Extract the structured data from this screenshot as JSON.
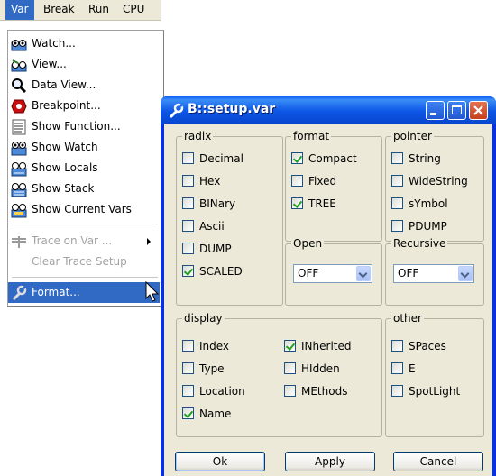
{
  "menubar": {
    "items": [
      {
        "label": "Var",
        "active": true
      },
      {
        "label": "Break"
      },
      {
        "label": "Run"
      },
      {
        "label": "CPU"
      }
    ]
  },
  "menu": {
    "items": [
      {
        "label": "Watch...",
        "icon": "watch-icon"
      },
      {
        "label": "View...",
        "icon": "view-icon"
      },
      {
        "label": "Data View...",
        "icon": "magnifier-icon"
      },
      {
        "label": "Breakpoint...",
        "icon": "breakpoint-icon"
      },
      {
        "label": "Show Function...",
        "icon": "function-icon"
      },
      {
        "label": "Show Watch",
        "icon": "watch-icon"
      },
      {
        "label": "Show Locals",
        "icon": "locals-icon"
      },
      {
        "label": "Show Stack",
        "icon": "stack-icon"
      },
      {
        "label": "Show Current Vars",
        "icon": "vars-icon"
      },
      {
        "label": "Trace on Var ...",
        "icon": "trace-icon",
        "disabled": true,
        "submenu": true
      },
      {
        "label": "Clear Trace Setup",
        "disabled": true
      },
      {
        "label": "Format...",
        "icon": "wrench-icon",
        "selected": true
      }
    ]
  },
  "dialog": {
    "title": "B::setup.var",
    "radix": {
      "title": "radix",
      "items": [
        {
          "label": "Decimal",
          "checked": false
        },
        {
          "label": "Hex",
          "checked": false
        },
        {
          "label": "BINary",
          "checked": false
        },
        {
          "label": "Ascii",
          "checked": false
        },
        {
          "label": "DUMP",
          "checked": false
        },
        {
          "label": "SCALED",
          "checked": true
        }
      ]
    },
    "format": {
      "title": "format",
      "items": [
        {
          "label": "Compact",
          "checked": true
        },
        {
          "label": "Fixed",
          "checked": false
        },
        {
          "label": "TREE",
          "checked": true
        }
      ],
      "open_label": "Open",
      "open_value": "OFF"
    },
    "pointer": {
      "title": "pointer",
      "items": [
        {
          "label": "String",
          "checked": false
        },
        {
          "label": "WideString",
          "checked": false
        },
        {
          "label": "sYmbol",
          "checked": false
        },
        {
          "label": "PDUMP",
          "checked": false
        }
      ],
      "recursive_label": "Recursive",
      "recursive_value": "OFF"
    },
    "display": {
      "title": "display",
      "col1": [
        {
          "label": "Index",
          "checked": false
        },
        {
          "label": "Type",
          "checked": false
        },
        {
          "label": "Location",
          "checked": false
        },
        {
          "label": "Name",
          "checked": true
        }
      ],
      "col2": [
        {
          "label": "INherited",
          "checked": true
        },
        {
          "label": "HIdden",
          "checked": false
        },
        {
          "label": "MEthods",
          "checked": false
        }
      ]
    },
    "other": {
      "title": "other",
      "items": [
        {
          "label": "SPaces",
          "checked": false
        },
        {
          "label": "E",
          "checked": false
        },
        {
          "label": "SpotLight",
          "checked": false
        }
      ]
    },
    "buttons": {
      "ok": "Ok",
      "apply": "Apply",
      "cancel": "Cancel"
    }
  },
  "colors": {
    "menu_highlight": "#316ac5",
    "titlebar": "#0a5ff5",
    "dialog_bg": "#ece9d8"
  }
}
